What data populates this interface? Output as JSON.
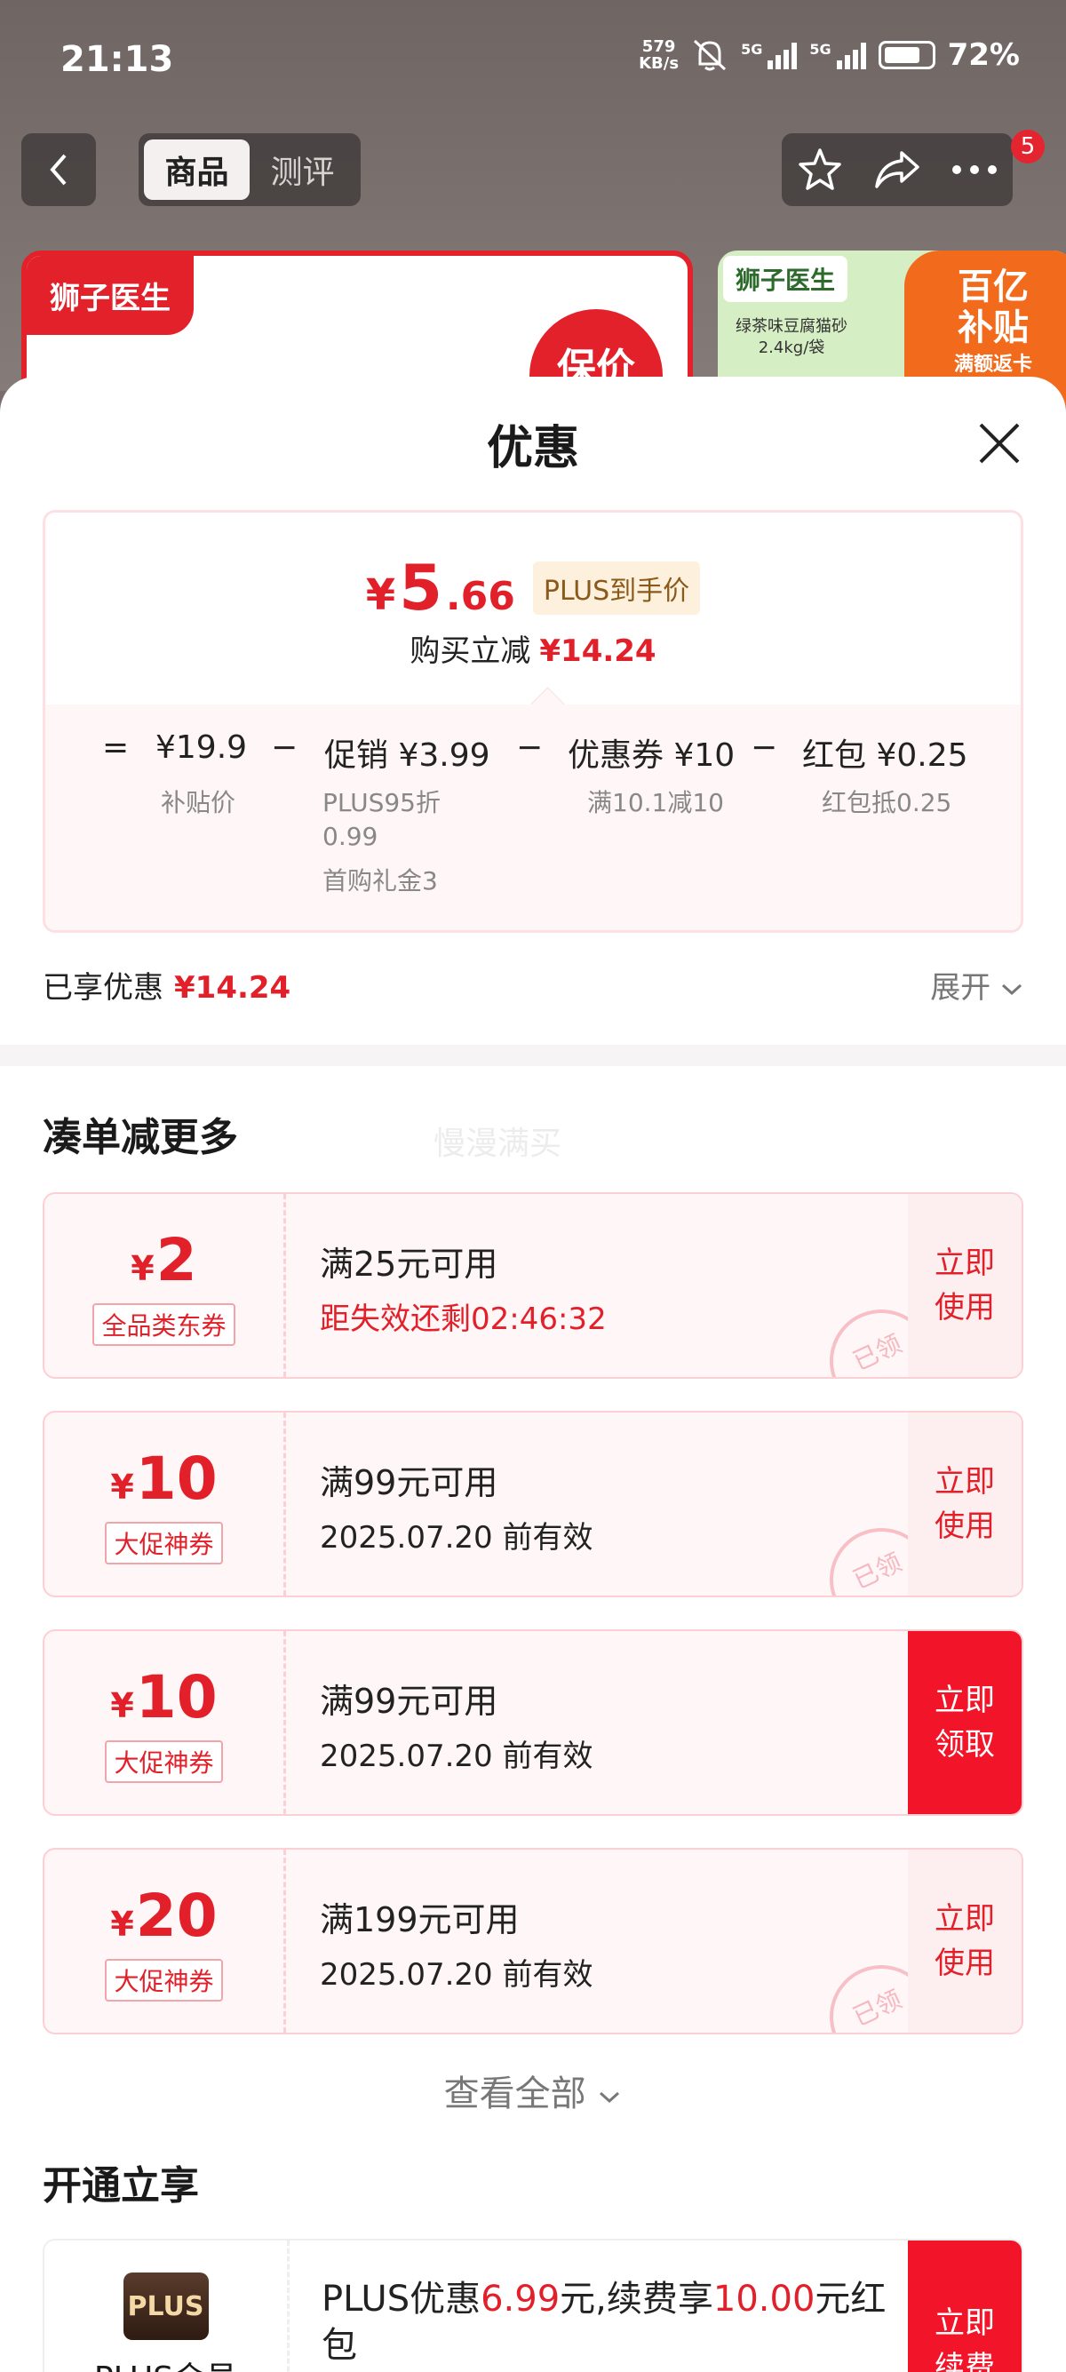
{
  "status_bar": {
    "time": "21:13",
    "net_speed_value": "579",
    "net_speed_unit": "KB/s",
    "signal1_label": "5G",
    "signal2_label": "5G",
    "battery": "72%"
  },
  "nav": {
    "tabs": [
      "商品",
      "测评"
    ],
    "active_tab": 0,
    "badge_count": "5"
  },
  "banners": {
    "brand": "狮子医生",
    "promo_text": "保价",
    "product_name": "绿茶味豆腐猫砂",
    "product_spec": "2.4kg/袋",
    "subsidy_line1": "百亿",
    "subsidy_line2": "补贴",
    "subsidy_sub": "满额返卡"
  },
  "sheet": {
    "title": "优惠",
    "final_price": {
      "currency": "¥",
      "integer": "5",
      "decimal": ".66",
      "tag": "PLUS到手价"
    },
    "reduce_label": "购买立减",
    "reduce_amount": "¥14.24",
    "breakdown": {
      "eq": "=",
      "minus": "−",
      "base_price": "¥19.9",
      "base_label": "补贴价",
      "promo": "促销 ¥3.99",
      "promo_sub1": "PLUS95折",
      "promo_sub2": "0.99",
      "promo_sub3": "首购礼金3",
      "coupon": "优惠券 ¥10",
      "coupon_sub": "满10.1减10",
      "redpacket": "红包 ¥0.25",
      "redpacket_sub": "红包抵0.25"
    },
    "enjoyed_label": "已享优惠",
    "enjoyed_amount": "¥14.24",
    "expand_label": "展开"
  },
  "more_section": {
    "title": "凑单减更多",
    "watermark": "慢漫满买",
    "coupons": [
      {
        "currency": "¥",
        "amount": "2",
        "tag": "全品类东券",
        "condition": "满25元可用",
        "expiry": "距失效还剩02:46:32",
        "button_line1": "立即",
        "button_line2": "使用",
        "stamp": "已领"
      },
      {
        "currency": "¥",
        "amount": "10",
        "tag": "大促神券",
        "condition": "满99元可用",
        "expiry": "2025.07.20 前有效",
        "button_line1": "立即",
        "button_line2": "使用",
        "stamp": "已领"
      },
      {
        "currency": "¥",
        "amount": "10",
        "tag": "大促神券",
        "condition": "满99元可用",
        "expiry": "2025.07.20 前有效",
        "button_line1": "立即",
        "button_line2": "领取"
      },
      {
        "currency": "¥",
        "amount": "20",
        "tag": "大促神券",
        "condition": "满199元可用",
        "expiry": "2025.07.20 前有效",
        "button_line1": "立即",
        "button_line2": "使用",
        "stamp": "已领"
      }
    ],
    "view_all": "查看全部"
  },
  "plus_section": {
    "title": "开通立享",
    "logo": "PLUS",
    "name": "PLUS会员",
    "text_a": "PLUS优惠",
    "amount_a": "6.99",
    "text_b": "元,续费享",
    "amount_b": "10.00",
    "text_c": "元红包",
    "button_line1": "立即",
    "button_line2": "续费"
  },
  "colors": {
    "accent_red": "#e2202a",
    "button_red": "#f2152a",
    "coupon_bg": "#fff6f7",
    "plus_tag_bg": "#fdf0dc"
  }
}
